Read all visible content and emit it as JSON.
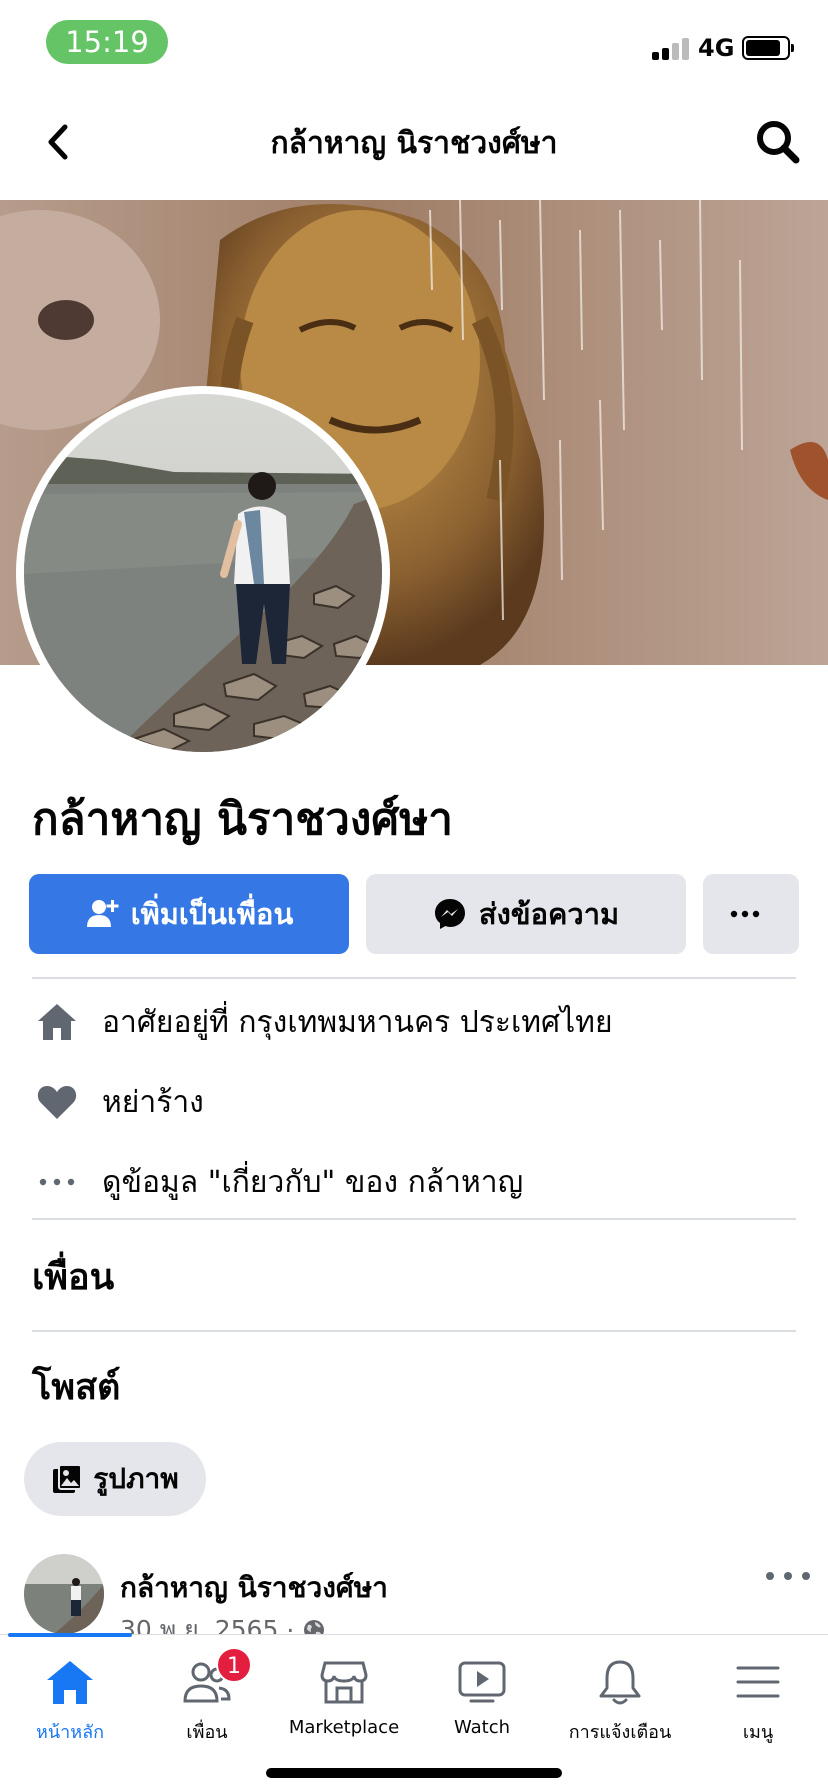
{
  "status_bar": {
    "time": "15:19",
    "network": "4G"
  },
  "header": {
    "title": "กล้าหาญ นิราชวงศ์ษา"
  },
  "profile": {
    "name": "กล้าหาญ นิราชวงศ์ษา",
    "add_friend_label": "เพิ่มเป็นเพื่อน",
    "message_label": "ส่งข้อความ"
  },
  "info": {
    "lives_in": "อาศัยอยู่ที่ กรุงเทพมหานคร ประเทศไทย",
    "relationship": "หย่าร้าง",
    "see_about": "ดูข้อมูล \"เกี่ยวกับ\" ของ กล้าหาญ"
  },
  "sections": {
    "friends_title": "เพื่อน",
    "posts_title": "โพสต์",
    "photos_chip": "รูปภาพ"
  },
  "post": {
    "author": "กล้าหาญ นิราชวงศ์ษา",
    "date": "30 พ.ย. 2565",
    "separator": "·"
  },
  "tabbar": {
    "items": [
      {
        "label": "หน้าหลัก",
        "icon": "home-icon",
        "active": true
      },
      {
        "label": "เพื่อน",
        "icon": "friends-icon",
        "badge": "1"
      },
      {
        "label": "Marketplace",
        "icon": "marketplace-icon"
      },
      {
        "label": "Watch",
        "icon": "watch-icon"
      },
      {
        "label": "การแจ้งเตือน",
        "icon": "bell-icon"
      },
      {
        "label": "เมนู",
        "icon": "menu-icon"
      }
    ]
  },
  "colors": {
    "accent": "#1877f2",
    "button_blue": "#3578e5",
    "button_gray": "#e4e6eb",
    "badge_red": "#e41e3f",
    "time_pill": "#65c466"
  }
}
